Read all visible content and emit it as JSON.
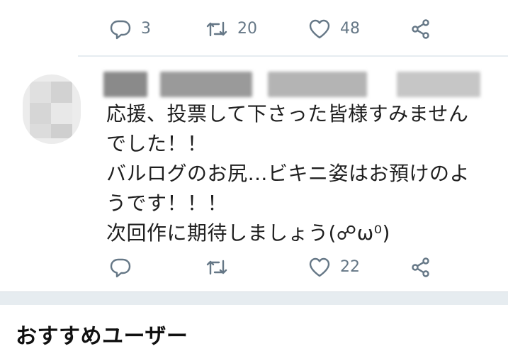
{
  "tweet_above": {
    "actions": {
      "reply_count": "3",
      "retweet_count": "20",
      "like_count": "48"
    }
  },
  "tweet": {
    "text": "応援、投票して下さった皆様すみません\nでした！！\nバルログのお尻…ビキニ姿はお預けのよ\nうです！！！\n次回作に期待しましょう(☍ω⁰)",
    "actions": {
      "reply_count": "",
      "retweet_count": "",
      "like_count": "22"
    }
  },
  "section": {
    "title": "おすすめユーザー"
  },
  "icons": {
    "reply": "reply-icon",
    "retweet": "retweet-icon",
    "like": "heart-icon",
    "share": "share-icon"
  },
  "colors": {
    "icon_gray": "#657786",
    "divider": "#e6ecf0"
  }
}
